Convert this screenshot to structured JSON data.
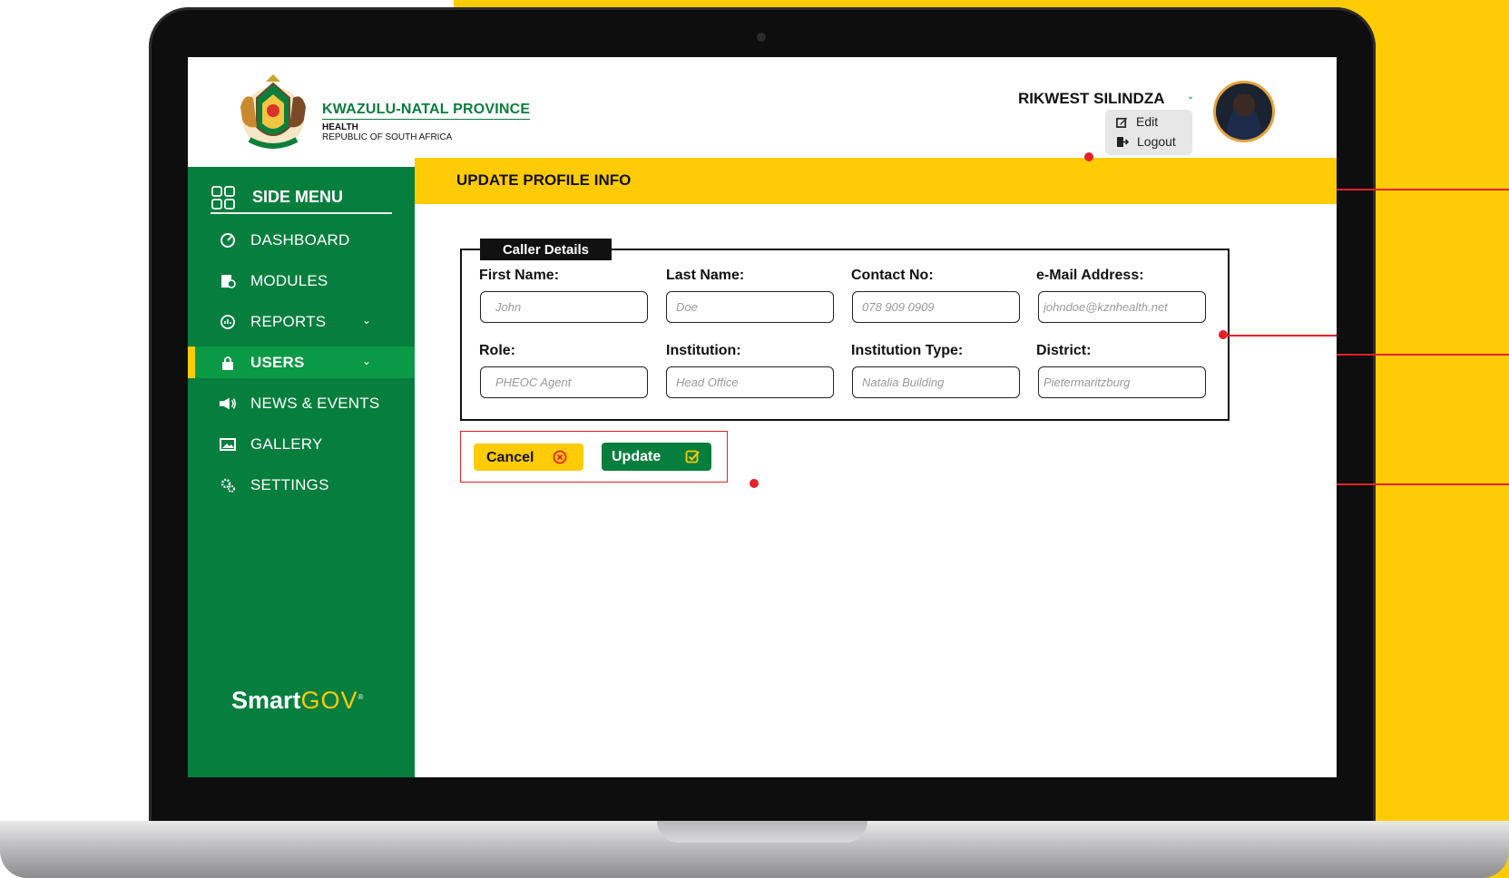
{
  "header": {
    "province_name": "KWAZULU-NATAL PROVINCE",
    "department": "HEALTH",
    "country": "REPUBLIC OF SOUTH AFRICA",
    "user_name": "RIKWEST SILINDZA",
    "user_menu": {
      "edit_label": "Edit",
      "logout_label": "Logout"
    }
  },
  "sidebar": {
    "title": "SIDE MENU",
    "items": [
      {
        "label": "DASHBOARD",
        "icon": "gauge-icon"
      },
      {
        "label": "MODULES",
        "icon": "modules-icon"
      },
      {
        "label": "REPORTS",
        "icon": "reports-icon",
        "has_submenu": true
      },
      {
        "label": "USERS",
        "icon": "users-icon",
        "has_submenu": true,
        "active": true
      },
      {
        "label": "NEWS & EVENTS",
        "icon": "megaphone-icon"
      },
      {
        "label": "GALLERY",
        "icon": "gallery-icon"
      },
      {
        "label": "SETTINGS",
        "icon": "settings-icon"
      }
    ],
    "brand_bold": "Smart",
    "brand_light": "GOV"
  },
  "main": {
    "title": "UPDATE PROFILE INFO",
    "section_title": "Caller Details",
    "fields": [
      {
        "label": "First Name:",
        "placeholder": "John"
      },
      {
        "label": "Last Name:",
        "placeholder": "Doe"
      },
      {
        "label": "Contact No:",
        "placeholder": "078 909 0909"
      },
      {
        "label": "e-Mail Address:",
        "placeholder": "johndoe@kznhealth.net"
      },
      {
        "label": "Role:",
        "placeholder": "PHEOC Agent"
      },
      {
        "label": "Institution:",
        "placeholder": "Head Office"
      },
      {
        "label": "Institution Type:",
        "placeholder": "Natalia Building"
      },
      {
        "label": "District:",
        "placeholder": "Pietermaritzburg"
      }
    ],
    "cancel_label": "Cancel",
    "update_label": "Update"
  },
  "colors": {
    "brand_green": "#067e3d",
    "active_green": "#0a9944",
    "brand_yellow": "#fecb05",
    "callout_red": "#e5202a"
  }
}
